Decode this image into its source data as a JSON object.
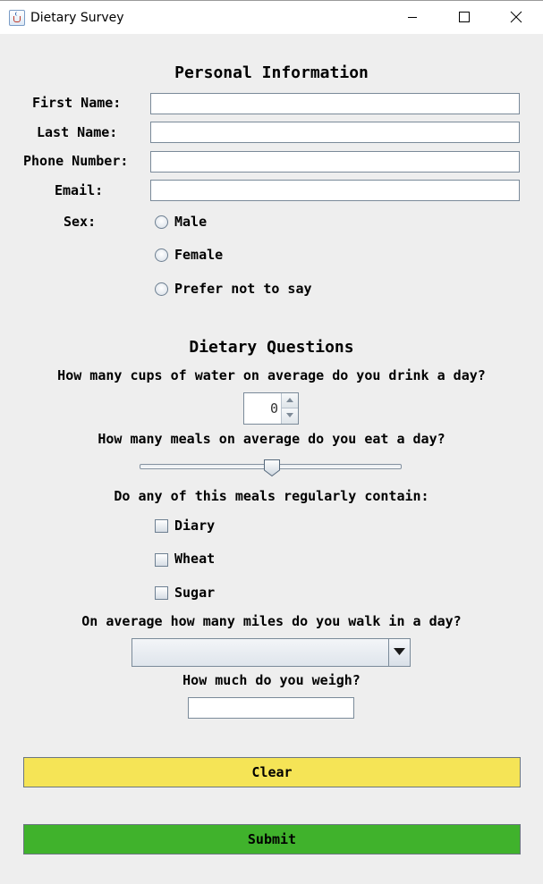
{
  "window": {
    "title": "Dietary Survey",
    "icon": "java-cup-icon"
  },
  "personal": {
    "section_title": "Personal Information",
    "first_name_label": "First Name:",
    "first_name_value": "",
    "last_name_label": "Last Name:",
    "last_name_value": "",
    "phone_label": "Phone Number:",
    "phone_value": "",
    "email_label": "Email:",
    "email_value": "",
    "sex_label": "Sex:",
    "sex_options": [
      "Male",
      "Female",
      "Prefer not to say"
    ],
    "sex_selected": null
  },
  "dietary": {
    "section_title": "Dietary Questions",
    "water_question": "How many cups of water on average do you drink a day?",
    "water_value": "0",
    "meals_question": "How many meals on average do you eat a day?",
    "meals_slider_fraction": 0.5,
    "contain_question": "Do any of this meals regularly contain:",
    "contain_options": [
      "Diary",
      "Wheat",
      "Sugar"
    ],
    "contain_checked": [
      false,
      false,
      false
    ],
    "miles_question": "On average how many miles do you walk in a day?",
    "miles_selected": "",
    "weight_question": "How much do you weigh?",
    "weight_value": ""
  },
  "buttons": {
    "clear_label": "Clear",
    "submit_label": "Submit"
  },
  "colors": {
    "background": "#eeeeee",
    "clear_button": "#f5e456",
    "submit_button": "#40b22c"
  }
}
